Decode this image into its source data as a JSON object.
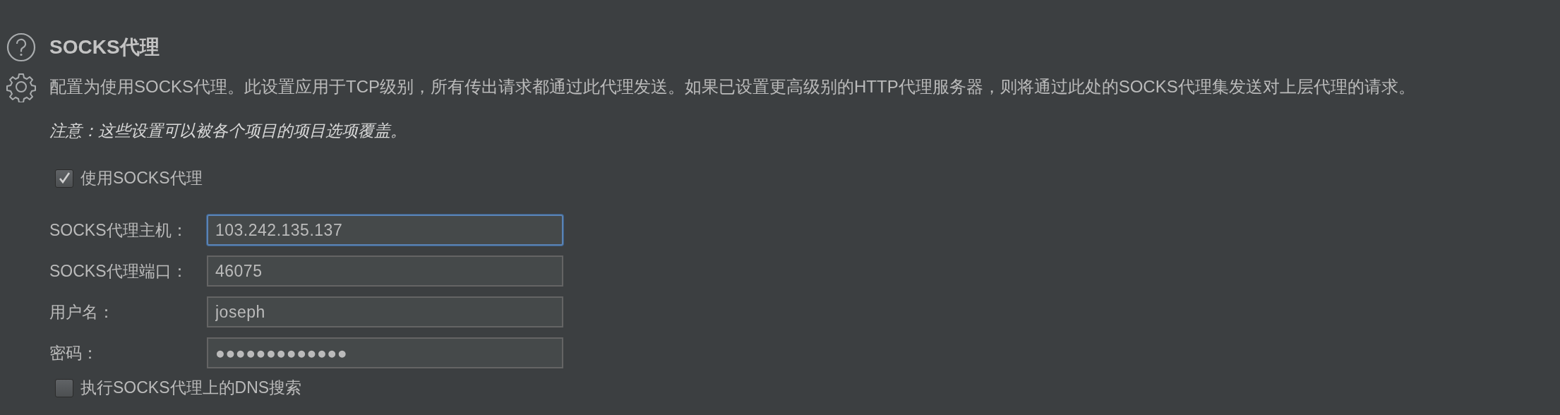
{
  "title": "SOCKS代理",
  "description": "配置为使用SOCKS代理。此设置应用于TCP级别，所有传出请求都通过此代理发送。如果已设置更高级别的HTTP代理服务器，则将通过此处的SOCKS代理集发送对上层代理的请求。",
  "note": "注意：这些设置可以被各个项目的项目选项覆盖。",
  "use_proxy": {
    "label": "使用SOCKS代理",
    "checked": true
  },
  "fields": [
    {
      "label": "SOCKS代理主机：",
      "value": "103.242.135.137",
      "focused": true
    },
    {
      "label": "SOCKS代理端口：",
      "value": "46075",
      "focused": false
    },
    {
      "label": "用户名：",
      "value": "joseph",
      "focused": false
    },
    {
      "label": "密码：",
      "value": "●●●●●●●●●●●●●",
      "focused": false
    }
  ],
  "dns_lookup": {
    "label": "执行SOCKS代理上的DNS搜索",
    "checked": false
  }
}
